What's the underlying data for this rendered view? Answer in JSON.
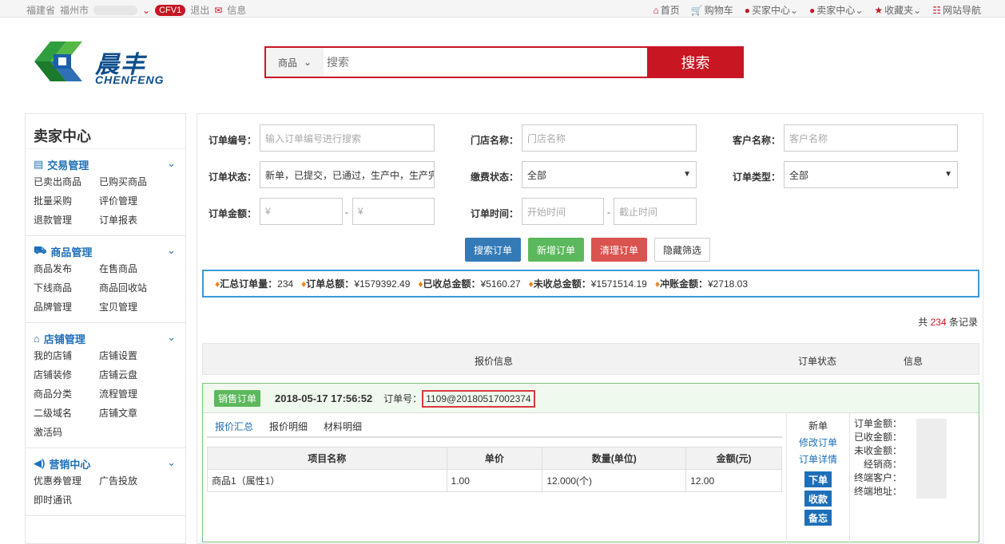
{
  "topbar": {
    "province": "福建省",
    "city": "福州市",
    "level": "CFV1",
    "logout": "退出",
    "message": "信息",
    "links": [
      "首页",
      "购物车",
      "买家中心",
      "卖家中心",
      "收藏夹",
      "网站导航"
    ]
  },
  "logo": {
    "cn": "晨丰",
    "en": "CHENFENG"
  },
  "search": {
    "category": "商品",
    "placeholder": "搜索",
    "button": "搜索"
  },
  "sidebar": {
    "title": "卖家中心",
    "groups": [
      {
        "title": "交易管理",
        "icon": "list-icon",
        "items": [
          "已卖出商品",
          "已购买商品",
          "批量采购",
          "评价管理",
          "退款管理",
          "订单报表"
        ]
      },
      {
        "title": "商品管理",
        "icon": "truck-icon",
        "items": [
          "商品发布",
          "在售商品",
          "下线商品",
          "商品回收站",
          "品牌管理",
          "宝贝管理"
        ]
      },
      {
        "title": "店铺管理",
        "icon": "home-icon",
        "items": [
          "我的店铺",
          "店铺设置",
          "店铺装修",
          "店铺云盘",
          "商品分类",
          "流程管理",
          "二级域名",
          "店铺文章",
          "激活码"
        ]
      },
      {
        "title": "营销中心",
        "icon": "speaker-icon",
        "items": [
          "优惠券管理",
          "广告投放",
          "即时通讯"
        ]
      }
    ]
  },
  "filters": {
    "order_no_label": "订单编号：",
    "order_no_placeholder": "输入订单编号进行搜索",
    "store_label": "门店名称：",
    "store_placeholder": "门店名称",
    "customer_label": "客户名称：",
    "customer_placeholder": "客户名称",
    "status_label": "订单状态：",
    "status_value": "新单，已提交，已通过，生产中，生产完",
    "pay_label": "缴费状态：",
    "pay_value": "全部",
    "type_label": "订单类型：",
    "type_value": "全部",
    "amount_label": "订单金额：",
    "amount_min": "¥",
    "amount_max": "¥",
    "time_label": "订单时间：",
    "time_start": "开始时间",
    "time_end": "截止时间",
    "dash": "-"
  },
  "buttons": {
    "search": "搜索订单",
    "add": "新增订单",
    "clear": "清理订单",
    "hide": "隐藏筛选"
  },
  "colors": {
    "primary": "#337ab7",
    "success": "#5cb85c",
    "danger": "#d9534f",
    "brand": "#c81623"
  },
  "summary": [
    {
      "label": "汇总订单量：",
      "value": "234"
    },
    {
      "label": "订单总额：",
      "value": "¥1579392.49"
    },
    {
      "label": "已收总金额：",
      "value": "¥5160.27"
    },
    {
      "label": "未收总金额：",
      "value": "¥1571514.19"
    },
    {
      "label": "冲账金额：",
      "value": "¥2718.03"
    }
  ],
  "records": {
    "prefix": "共",
    "count": "234",
    "suffix": "条记录"
  },
  "table_header": {
    "quote": "报价信息",
    "status": "订单状态",
    "info": "信息"
  },
  "order": {
    "badge": "销售订单",
    "date": "2018-05-17 17:56:52",
    "no_label": "订单号：",
    "no": "1109@20180517002374",
    "tabs": [
      "报价汇总",
      "报价明细",
      "材料明细"
    ],
    "columns": [
      "项目名称",
      "单价",
      "数量(单位)",
      "金额(元)"
    ],
    "rows": [
      [
        "商品1（属性1）",
        "1.00",
        "12.000(个)",
        "12.00"
      ]
    ],
    "status": "新单",
    "links": [
      "修改订单",
      "订单详情"
    ],
    "actions": [
      "下单",
      "收款",
      "备忘"
    ],
    "info_labels": [
      "订单金额：",
      "已收金额：",
      "未收金额：",
      "经销商：",
      "终端客户：",
      "终端地址："
    ]
  }
}
